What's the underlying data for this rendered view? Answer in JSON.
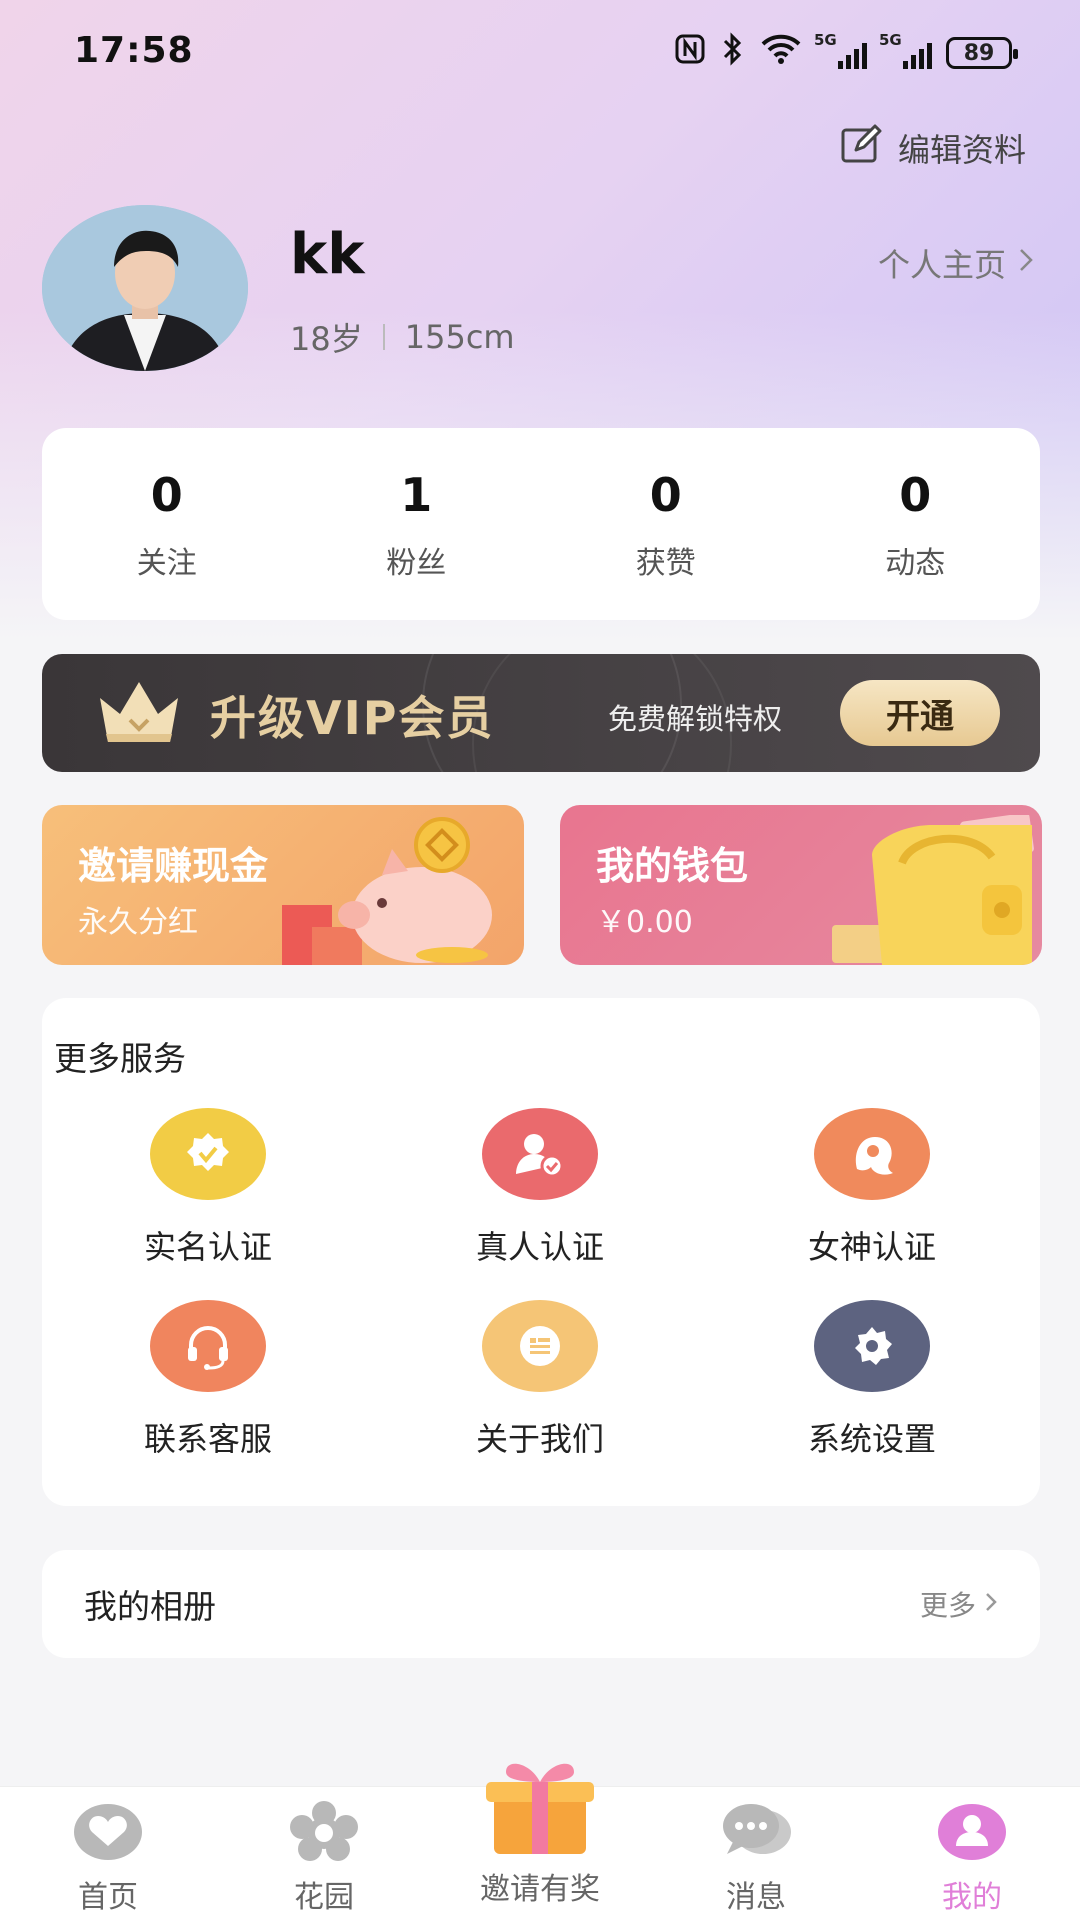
{
  "status_bar": {
    "time": "17:58",
    "network_tag": "5G",
    "battery": "89",
    "icons": [
      "nfc-icon",
      "bluetooth-icon",
      "wifi-icon",
      "signal-icon",
      "signal-icon",
      "battery-icon"
    ]
  },
  "header": {
    "edit_label": "编辑资料",
    "nickname": "kk",
    "age": "18岁",
    "height": "155cm",
    "homepage_label": "个人主页"
  },
  "stats": [
    {
      "value": "0",
      "label": "关注"
    },
    {
      "value": "1",
      "label": "粉丝"
    },
    {
      "value": "0",
      "label": "获赞"
    },
    {
      "value": "0",
      "label": "动态"
    }
  ],
  "vip": {
    "title": "升级VIP会员",
    "subtitle": "免费解锁特权",
    "button": "开通"
  },
  "promos": {
    "invite": {
      "title": "邀请赚现金",
      "subtitle": "永久分红"
    },
    "wallet": {
      "title": "我的钱包",
      "balance": "￥0.00"
    }
  },
  "services": {
    "title": "更多服务",
    "items": [
      {
        "label": "实名认证",
        "icon": "verified-badge-icon",
        "color": "#f2cc45"
      },
      {
        "label": "真人认证",
        "icon": "user-check-icon",
        "color": "#ea6a6d"
      },
      {
        "label": "女神认证",
        "icon": "goddess-icon",
        "color": "#f08a5c"
      },
      {
        "label": "联系客服",
        "icon": "headset-icon",
        "color": "#f0855e"
      },
      {
        "label": "关于我们",
        "icon": "info-card-icon",
        "color": "#f5c576"
      },
      {
        "label": "系统设置",
        "icon": "settings-icon",
        "color": "#5d6380"
      }
    ]
  },
  "album": {
    "title": "我的相册",
    "more": "更多"
  },
  "tabbar": {
    "active_color": "#e07fd8",
    "items": [
      {
        "label": "首页",
        "icon": "heart-icon"
      },
      {
        "label": "花园",
        "icon": "flower-icon"
      },
      {
        "label": "邀请有奖",
        "icon": "gift-icon"
      },
      {
        "label": "消息",
        "icon": "chat-icon"
      },
      {
        "label": "我的",
        "icon": "profile-icon",
        "active": true
      }
    ]
  }
}
